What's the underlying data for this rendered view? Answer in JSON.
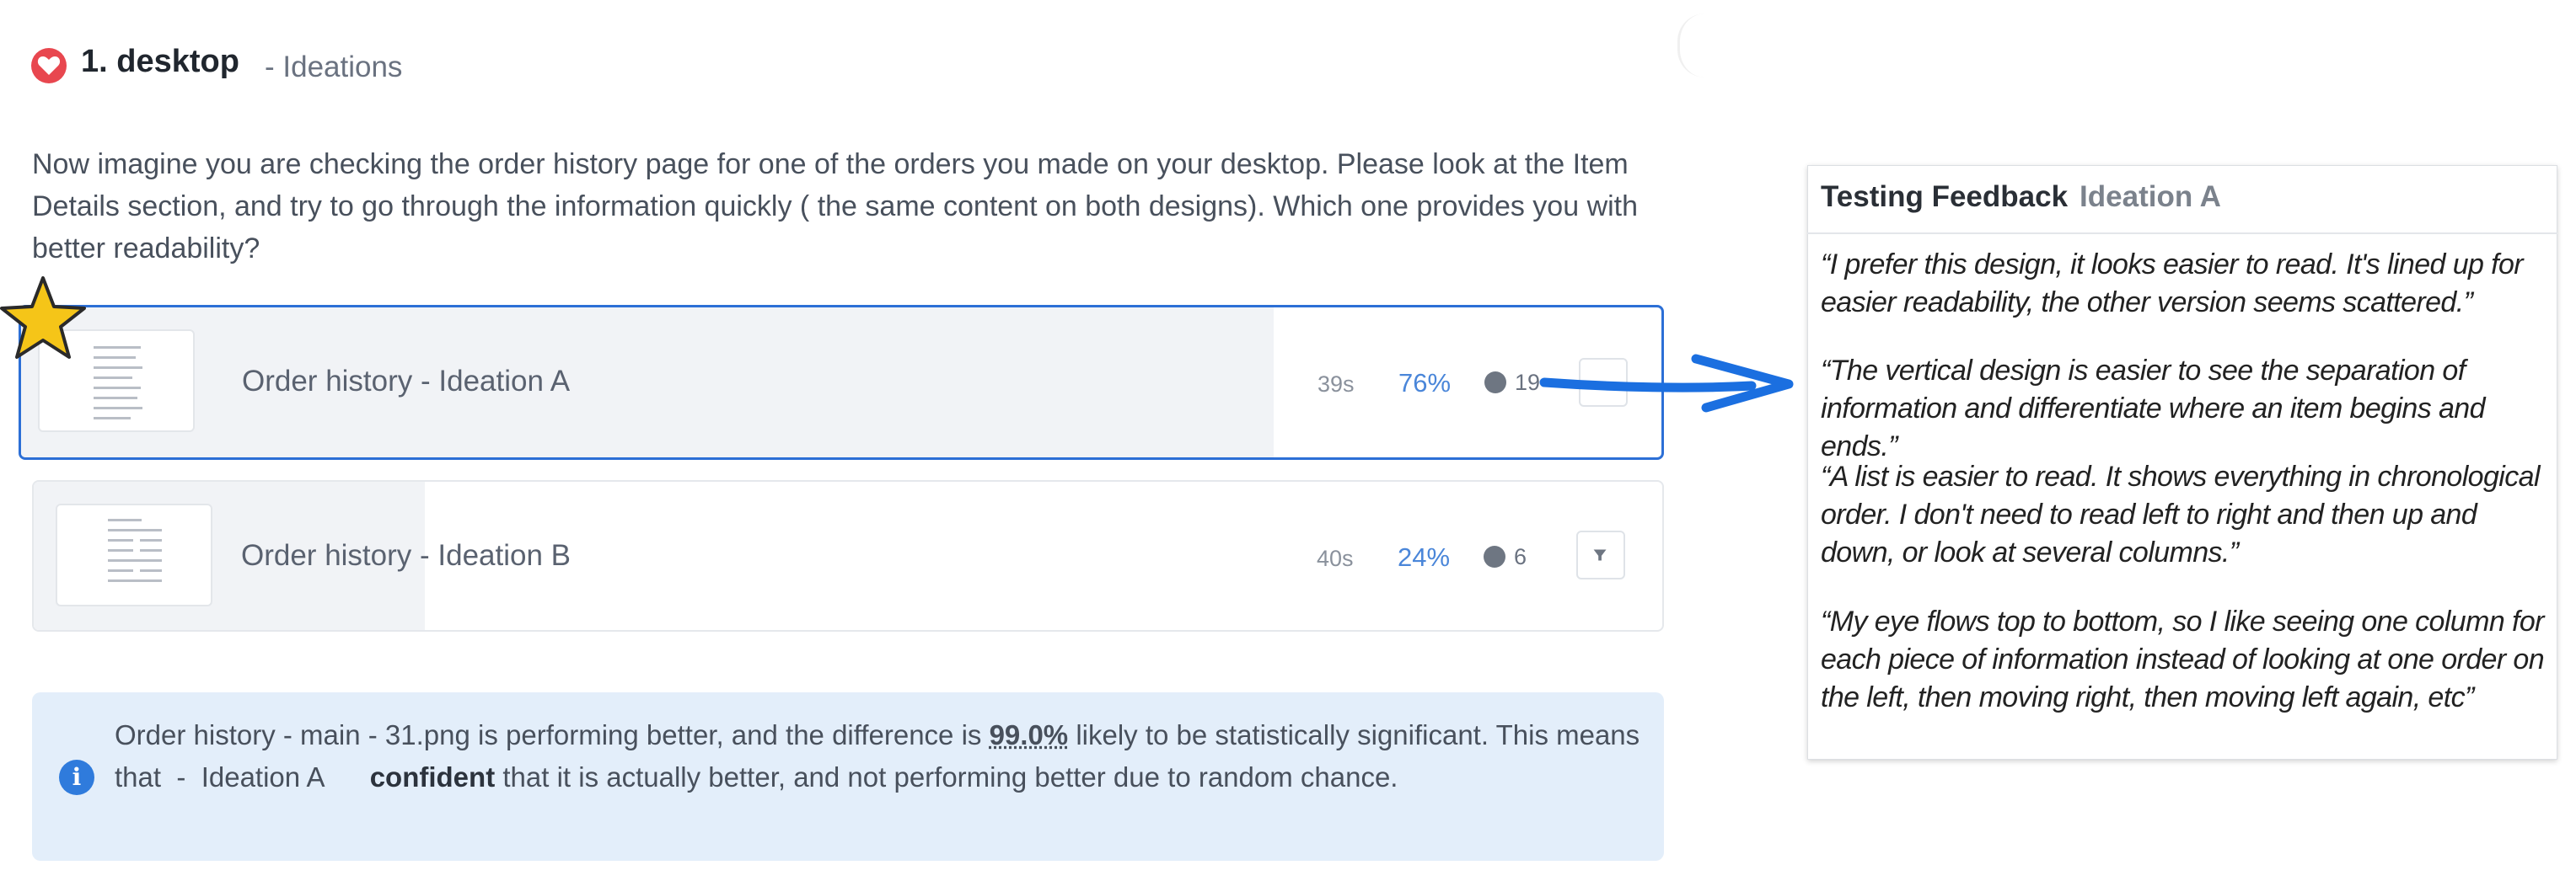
{
  "header": {
    "title": "1. desktop",
    "subtitle": "- Ideations"
  },
  "question": "Now imagine you are checking the order history page for one of the orders you made on your desktop. Please look at the Item Details section, and try to go through the information quickly ( the same content on both designs). Which one provides you with better readability?",
  "options": [
    {
      "name": "Order history  - Ideation A",
      "time": "39s",
      "percent": "76%",
      "count": "19",
      "share": 0.76,
      "selected": true
    },
    {
      "name": "Order history  - Ideation B",
      "time": "40s",
      "percent": "24%",
      "count": "6",
      "share": 0.24,
      "selected": false
    }
  ],
  "info": {
    "text_a": "Order history - main - 31.png is performing better, and the difference is ",
    "pct": "99.0%",
    "text_b": " likely to be statistically significant. This means that  -  Ideation A      ",
    "bold": "confident",
    "text_c": " that it is actually better, and not performing better due to random chance."
  },
  "feedback": {
    "title": "Testing Feedback",
    "subtitle": "Ideation A",
    "quotes": [
      "“I prefer this design, it looks easier to read. It's lined up for easier readability, the other version seems scattered.”",
      "“The vertical design is easier to see the separation of information and differentiate where an item begins and ends.”",
      "“A list is easier to read. It shows everything in chronological order. I don't need to read left to right and then up and down, or look at several columns.”",
      "“My eye flows top to bottom, so I like seeing one column for each piece of information instead of looking at one order on the left, then moving right, then moving left again, etc”"
    ]
  },
  "colors": {
    "accent": "#2c6fd6",
    "heart": "#e8474f",
    "info_bg": "#e3eefa",
    "star": "#f5c518",
    "arrow": "#1b6fe0"
  },
  "icons": [
    "heart-icon",
    "user-icon",
    "filter-icon",
    "info-icon",
    "star-icon",
    "arrow-icon"
  ]
}
